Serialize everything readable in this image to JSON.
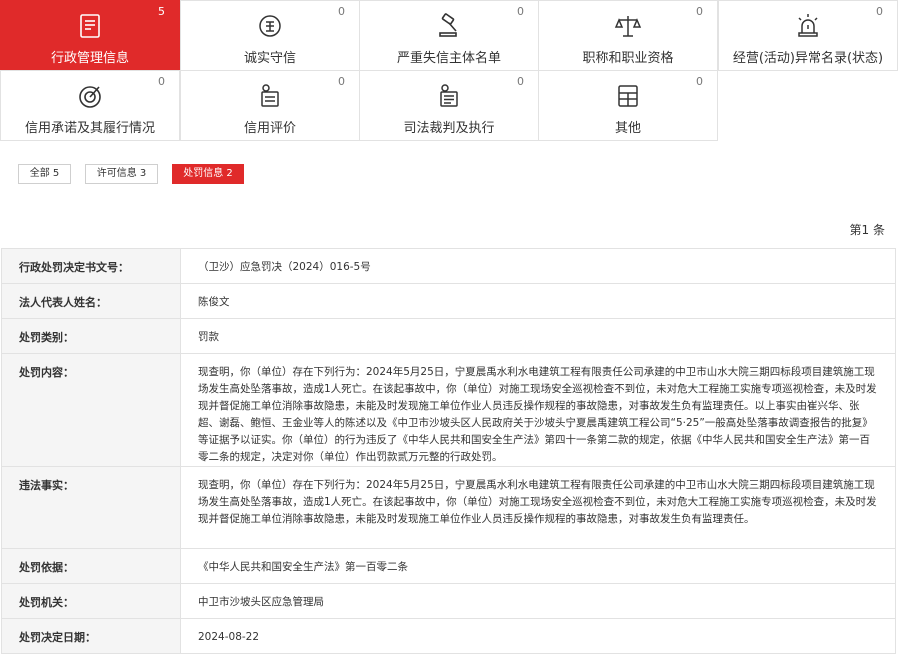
{
  "categories": [
    {
      "label": "行政管理信息",
      "count": "5",
      "icon": "document-list-icon",
      "active": true
    },
    {
      "label": "诚实守信",
      "count": "0",
      "icon": "credit-seal-icon",
      "active": false
    },
    {
      "label": "严重失信主体名单",
      "count": "0",
      "icon": "gavel-icon",
      "active": false
    },
    {
      "label": "职称和职业资格",
      "count": "0",
      "icon": "scales-icon",
      "active": false
    },
    {
      "label": "经营(活动)异常名录(状态)",
      "count": "0",
      "icon": "alarm-light-icon",
      "active": false
    },
    {
      "label": "信用承诺及其履行情况",
      "count": "0",
      "icon": "target-icon",
      "active": false
    },
    {
      "label": "信用评价",
      "count": "0",
      "icon": "person-certificate-icon",
      "active": false
    },
    {
      "label": "司法裁判及执行",
      "count": "0",
      "icon": "person-document-icon",
      "active": false
    },
    {
      "label": "其他",
      "count": "0",
      "icon": "grid-card-icon",
      "active": false
    }
  ],
  "filters": [
    {
      "label": "全部 5",
      "active": false
    },
    {
      "label": "许可信息 3",
      "active": false
    },
    {
      "label": "处罚信息 2",
      "active": true
    }
  ],
  "page_info": "第1 条",
  "records": [
    {
      "key": "行政处罚决定书文号：",
      "value": "（卫沙）应急罚决（2024）016-5号"
    },
    {
      "key": "法人代表人姓名：",
      "value": "陈俊文"
    },
    {
      "key": "处罚类别：",
      "value": "罚款"
    },
    {
      "key": "处罚内容：",
      "value": "现查明，你（单位）存在下列行为：2024年5月25日，宁夏晨禹水利水电建筑工程有限责任公司承建的中卫市山水大院三期四标段项目建筑施工现场发生高处坠落事故，造成1人死亡。在该起事故中，你（单位）对施工现场安全巡视检查不到位，未对危大工程施工实施专项巡视检查，未及时发现并督促施工单位消除事故隐患，未能及时发现施工单位作业人员违反操作规程的事故隐患，对事故发生负有监理责任。以上事实由崔兴华、张超、谢磊、鲍恒、王金业等人的陈述以及《中卫市沙坡头区人民政府关于沙坡头宁夏晨禹建筑工程公司“5·25”一般高处坠落事故调查报告的批复》等证据予以证实。你（单位）的行为违反了《中华人民共和国安全生产法》第四十一条第二款的规定，依据《中华人民共和国安全生产法》第一百零二条的规定，决定对你（单位）作出罚款贰万元整的行政处罚。"
    },
    {
      "key": "违法事实：",
      "value": "现查明，你（单位）存在下列行为：2024年5月25日，宁夏晨禹水利水电建筑工程有限责任公司承建的中卫市山水大院三期四标段项目建筑施工现场发生高处坠落事故，造成1人死亡。在该起事故中，你（单位）对施工现场安全巡视检查不到位，未对危大工程施工实施专项巡视检查，未及时发现并督促施工单位消除事故隐患，未能及时发现施工单位作业人员违反操作规程的事故隐患，对事故发生负有监理责任。"
    },
    {
      "key": "处罚依据：",
      "value": "《中华人民共和国安全生产法》第一百零二条"
    },
    {
      "key": "处罚机关：",
      "value": "中卫市沙坡头区应急管理局"
    },
    {
      "key": "处罚决定日期：",
      "value": "2024-08-22"
    }
  ],
  "colors": {
    "accent": "#e02a2a",
    "border": "#e2e2e2",
    "key_bg": "#f5f5f5"
  }
}
